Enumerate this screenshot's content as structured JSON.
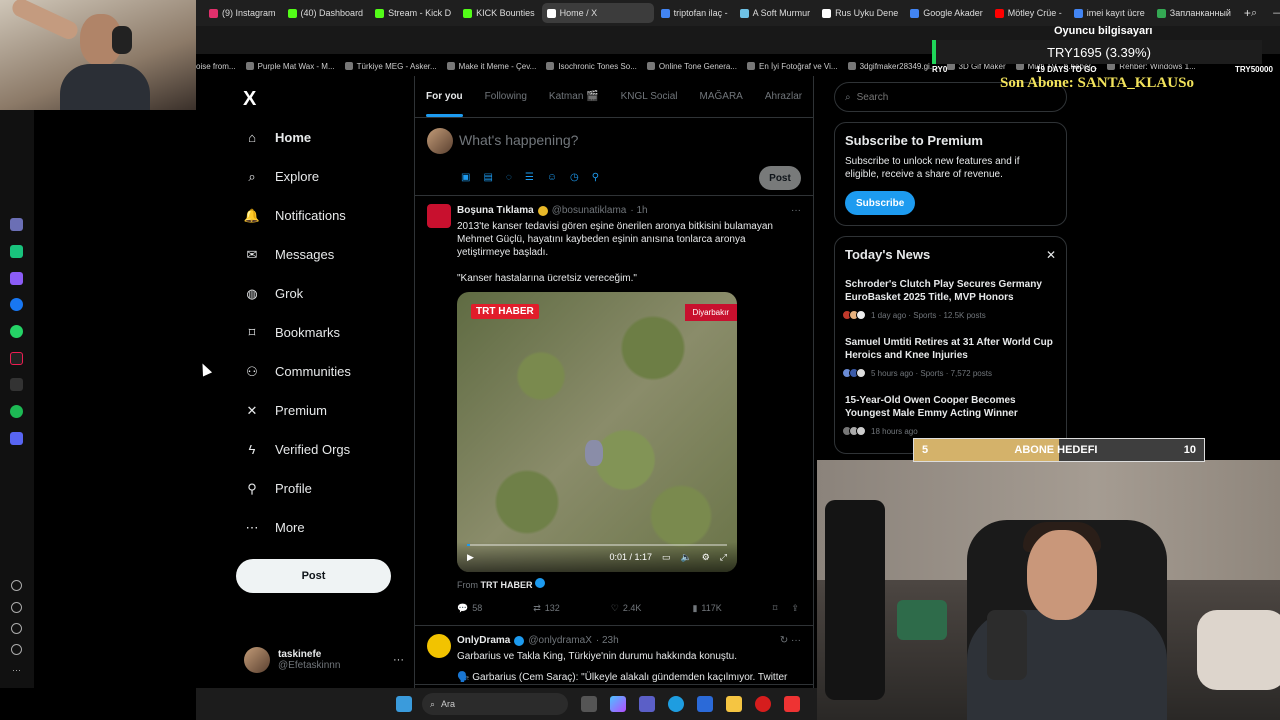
{
  "browser": {
    "tabs": [
      {
        "label": "(9) Instagram",
        "color": "#e1306c"
      },
      {
        "label": "(40) Dashboard",
        "color": "#53fc18"
      },
      {
        "label": "Stream - Kick D",
        "color": "#53fc18"
      },
      {
        "label": "KICK Bounties",
        "color": "#53fc18"
      },
      {
        "label": "Home / X",
        "color": "#ffffff",
        "active": true
      },
      {
        "label": "triptofan ilaç -",
        "color": "#4285f4"
      },
      {
        "label": "A Soft Murmur",
        "color": "#6ec1e4"
      },
      {
        "label": "Rus Uyku Dene",
        "color": "#ffffff"
      },
      {
        "label": "Google Akader",
        "color": "#4285f4"
      },
      {
        "label": "Mötley Crüe -",
        "color": "#ff0000"
      },
      {
        "label": "imei kayıt ücre",
        "color": "#4285f4"
      },
      {
        "label": "Запланканный",
        "color": "#34a853"
      }
    ],
    "new_tab": "+",
    "bookmarks": [
      {
        "label": "oise from..."
      },
      {
        "label": "Purple Mat Wax - M..."
      },
      {
        "label": "Türkiye MEG - Asker..."
      },
      {
        "label": "Make it Meme - Çev..."
      },
      {
        "label": "Isochronic Tones So..."
      },
      {
        "label": "Online Tone Genera..."
      },
      {
        "label": "En İyi Fotoğraf ve Vi..."
      },
      {
        "label": "3dgifmaker28349.gi..."
      },
      {
        "label": "3D Gif Maker"
      },
      {
        "label": "Multi TV - b.haber..."
      },
      {
        "label": "Rehber: Windows 1..."
      }
    ]
  },
  "overlay": {
    "oyuncu": "Oyuncu bilgisayarı",
    "try_box": "TRY1695 (3.39%)",
    "try_left": "RY0",
    "try_mid": "19 DAYS TO GO",
    "try_right": "TRY50000",
    "son_abone": "Son Abone: SANTA_KLAUSo",
    "abone_left": "5",
    "abone_center": "ABONE HEDEFI",
    "abone_right": "10",
    "abone_progress": 0.5
  },
  "x": {
    "logo": "X",
    "nav": [
      {
        "label": "Home",
        "icon": "home-icon",
        "active": true
      },
      {
        "label": "Explore",
        "icon": "search-icon"
      },
      {
        "label": "Notifications",
        "icon": "bell-icon"
      },
      {
        "label": "Messages",
        "icon": "envelope-icon"
      },
      {
        "label": "Grok",
        "icon": "grok-icon"
      },
      {
        "label": "Bookmarks",
        "icon": "bookmark-icon"
      },
      {
        "label": "Communities",
        "icon": "people-icon"
      },
      {
        "label": "Premium",
        "icon": "x-icon"
      },
      {
        "label": "Verified Orgs",
        "icon": "lightning-icon"
      },
      {
        "label": "Profile",
        "icon": "person-icon"
      },
      {
        "label": "More",
        "icon": "more-circle-icon"
      }
    ],
    "post_button": "Post",
    "account": {
      "name": "taskinefe",
      "handle": "@Efetaskinnn",
      "more": "···"
    },
    "timeline_tabs": [
      "For you",
      "Following",
      "Katman 🎬",
      "KNGL Social",
      "MAĞARA",
      "Ahrazlar"
    ],
    "compose": {
      "placeholder": "What's happening?",
      "post_label": "Post"
    },
    "tweets": [
      {
        "name": "Boşuna Tıklama",
        "handle": "@bosunatiklama",
        "time": "· 1h",
        "text": "2013'te kanser tedavisi gören eşine önerilen aronya bitkisini bulamayan Mehmet Güçlü, hayatını kaybeden eşinin anısına tonlarca aronya yetiştirmeye başladı.",
        "quote": "\"Kanser hastalarına ücretsiz vereceğim.\"",
        "media": {
          "brand": "TRT HABER",
          "location": "Diyarbakır",
          "time": "0:01 / 1:17",
          "progress": 0.013
        },
        "from_label": "From",
        "from_source": "TRT HABER",
        "replies": "58",
        "reposts": "132",
        "likes": "2.4K",
        "views": "117K"
      },
      {
        "name": "OnlyDrama",
        "handle": "@onlydramaX",
        "time": "· 23h",
        "text": "Garbarius ve Takla King, Türkiye'nin durumu hakkında konuştu.",
        "quote": "🗣️ Garbarius (Cem Saraç): \"Ülkeyle alakalı gündemden kaçılmıyor. Twitter"
      }
    ],
    "search": {
      "placeholder": "Search"
    },
    "premium": {
      "title": "Subscribe to Premium",
      "text": "Subscribe to unlock new features and if eligible, receive a share of revenue.",
      "button": "Subscribe"
    },
    "news": {
      "title": "Today's News",
      "close": "✕",
      "items": [
        {
          "title": "Schroder's Clutch Play Secures Germany EuroBasket 2025 Title, MVP Honors",
          "meta": "1 day ago · Sports · 12.5K posts"
        },
        {
          "title": "Samuel Umtiti Retires at 31 After World Cup Heroics and Knee Injuries",
          "meta": "5 hours ago · Sports · 7,572 posts"
        },
        {
          "title": "15-Year-Old Owen Cooper Becomes Youngest Male Emmy Acting Winner",
          "meta": "18 hours ago"
        }
      ]
    }
  },
  "taskbar": {
    "search": "Ara"
  }
}
